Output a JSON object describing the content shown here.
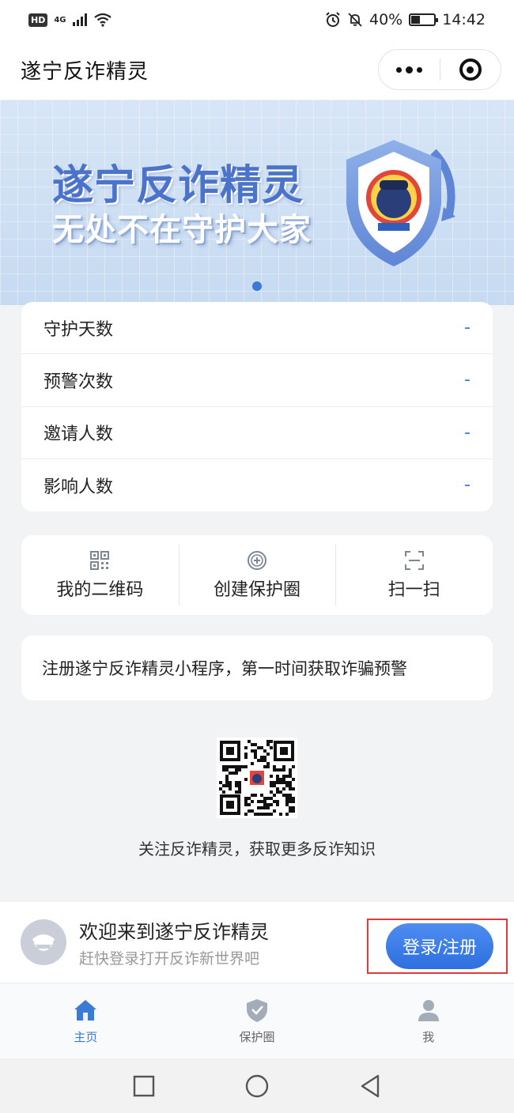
{
  "status_bar": {
    "hd": "HD",
    "network": "4G",
    "battery_percent": "40%",
    "battery_level": 0.4,
    "time": "14:42"
  },
  "header": {
    "title": "遂宁反诈精灵"
  },
  "banner": {
    "title": "遂宁反诈精灵",
    "subtitle": "无处不在守护大家"
  },
  "stats": [
    {
      "label": "守护天数",
      "value": "-"
    },
    {
      "label": "预警次数",
      "value": "-"
    },
    {
      "label": "邀请人数",
      "value": "-"
    },
    {
      "label": "影响人数",
      "value": "-"
    }
  ],
  "actions": [
    {
      "label": "我的二维码",
      "icon": "qrcode-icon"
    },
    {
      "label": "创建保护圈",
      "icon": "add-circle-icon"
    },
    {
      "label": "扫一扫",
      "icon": "scan-icon"
    }
  ],
  "notice": {
    "text": "注册遂宁反诈精灵小程序，第一时间获取诈骗预警"
  },
  "qr": {
    "caption": "关注反诈精灵，获取更多反诈知识"
  },
  "login": {
    "title": "欢迎来到遂宁反诈精灵",
    "subtitle": "赶快登录打开反诈新世界吧",
    "button_label": "登录/注册"
  },
  "tabs": [
    {
      "label": "主页",
      "icon": "home-icon",
      "active": true
    },
    {
      "label": "保护圈",
      "icon": "shield-icon",
      "active": false
    },
    {
      "label": "我",
      "icon": "user-icon",
      "active": false
    }
  ],
  "colors": {
    "accent": "#3a7bd5",
    "banner_title": "#4a73c9",
    "highlight": "#e03a3a"
  }
}
